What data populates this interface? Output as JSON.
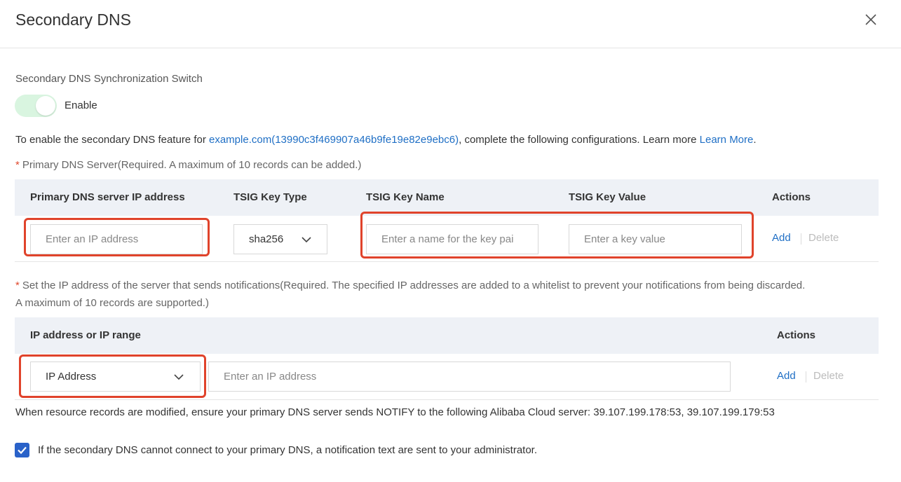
{
  "dialog": {
    "title": "Secondary DNS",
    "close_icon": "close-icon"
  },
  "sync_switch": {
    "label": "Secondary DNS Synchronization Switch",
    "state_label": "Enable",
    "enabled": true,
    "color_track": "#d9f5e0"
  },
  "intro": {
    "prefix": "To enable the secondary DNS feature for ",
    "domain_link": "example.com(13990c3f469907a46b9fe19e82e9ebc6)",
    "middle": ", complete the following configurations. Learn more ",
    "learn_more": "Learn More",
    "suffix": "."
  },
  "primary_server": {
    "required_mark": "*",
    "label": "Primary DNS Server(Required. A maximum of 10 records can be added.)",
    "columns": [
      "Primary DNS server IP address",
      "TSIG Key Type",
      "TSIG Key Name",
      "TSIG Key Value",
      "Actions"
    ],
    "row": {
      "ip_placeholder": "Enter an IP address",
      "key_type": "sha256",
      "key_name_placeholder": "Enter a name for the key pai",
      "key_value_placeholder": "Enter a key value",
      "add": "Add",
      "delete": "Delete"
    }
  },
  "notify_servers": {
    "required_mark": "*",
    "label_line1": "Set the IP address of the server that sends notifications(Required. The specified IP addresses are added to a whitelist to prevent your notifications from being discarded.",
    "label_line2": "A maximum of 10 records are supported.)",
    "columns": [
      "IP address or IP range",
      "Actions"
    ],
    "row": {
      "type": "IP Address",
      "ip_placeholder": "Enter an IP address",
      "add": "Add",
      "delete": "Delete"
    }
  },
  "notify_note": "When resource records are modified, ensure your primary DNS server sends NOTIFY to the following Alibaba Cloud server: 39.107.199.178:53, 39.107.199.179:53",
  "admin_notification": {
    "checked": true,
    "label": "If the secondary DNS cannot connect to your primary DNS, a notification text are sent to your administrator."
  },
  "colors": {
    "accent": "#1f6fc5",
    "highlight": "#e0432b",
    "checkbox": "#2a62c9"
  }
}
